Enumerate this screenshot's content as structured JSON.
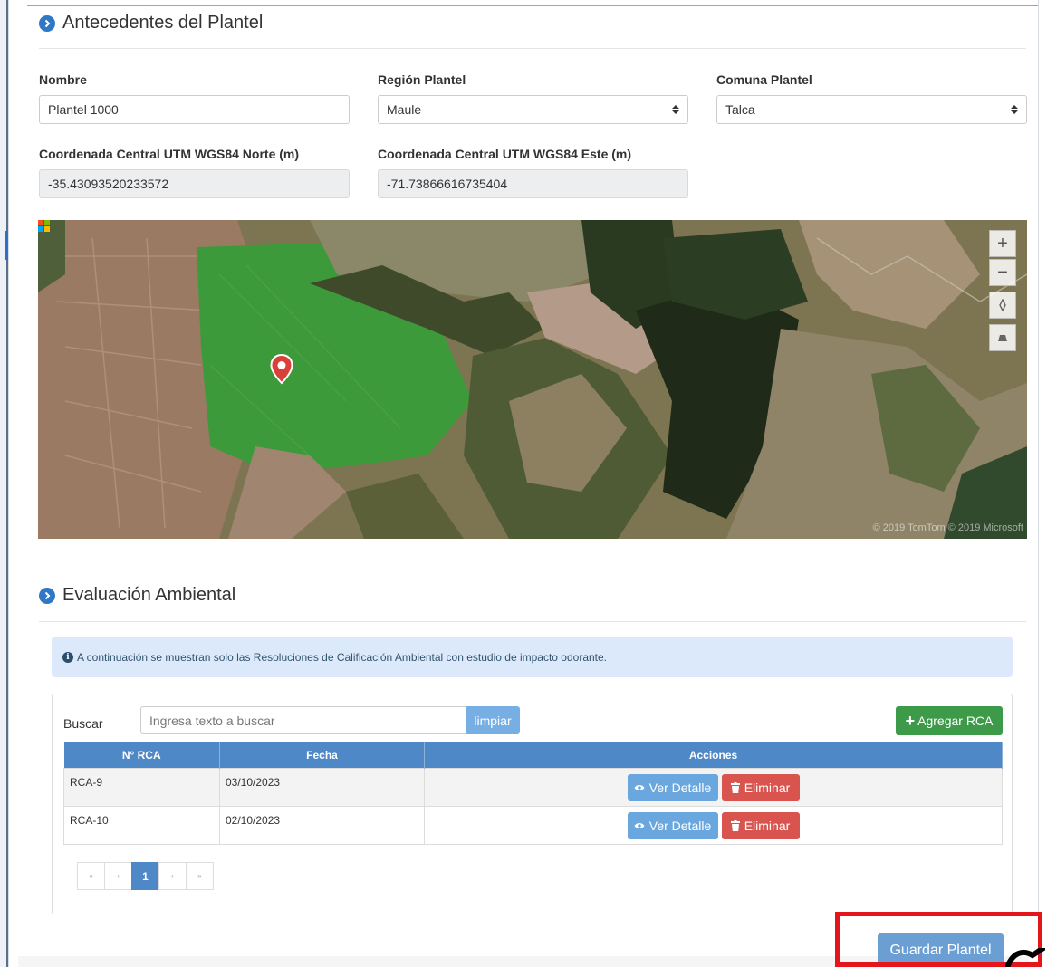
{
  "sections": {
    "antecedentes_title": "Antecedentes del Plantel",
    "evaluacion_title": "Evaluación Ambiental"
  },
  "form": {
    "nombre_label": "Nombre",
    "nombre_value": "Plantel 1000",
    "region_label": "Región Plantel",
    "region_value": "Maule",
    "comuna_label": "Comuna Plantel",
    "comuna_value": "Talca",
    "norte_label": "Coordenada Central UTM WGS84 Norte (m)",
    "norte_value": "-35.43093520233572",
    "este_label": "Coordenada Central UTM WGS84 Este (m)",
    "este_value": "-71.73866616735404"
  },
  "map": {
    "zoom_in": "+",
    "zoom_out": "−",
    "attribution": "© 2019 TomTom © 2019 Microsoft"
  },
  "alert": {
    "text": "A continuación se muestran solo las Resoluciones de Calificación Ambiental con estudio de impacto odorante."
  },
  "search": {
    "label": "Buscar",
    "placeholder": "Ingresa texto a buscar",
    "clear_label": "limpiar",
    "add_label": "Agregar RCA"
  },
  "table": {
    "headers": [
      "N° RCA",
      "Fecha",
      "Acciones"
    ],
    "rows": [
      {
        "rca": "RCA-9",
        "fecha": "03/10/2023"
      },
      {
        "rca": "RCA-10",
        "fecha": "02/10/2023"
      }
    ],
    "view_label": "Ver Detalle",
    "delete_label": "Eliminar"
  },
  "pagination": {
    "first": "«",
    "prev": "‹",
    "current": "1",
    "next": "›",
    "last": "»"
  },
  "footer": {
    "save_label": "Guardar Plantel"
  },
  "colors": {
    "primary": "#4f88c6",
    "success": "#3c9a48",
    "danger": "#d9534f",
    "highlight": "#e5161b"
  }
}
